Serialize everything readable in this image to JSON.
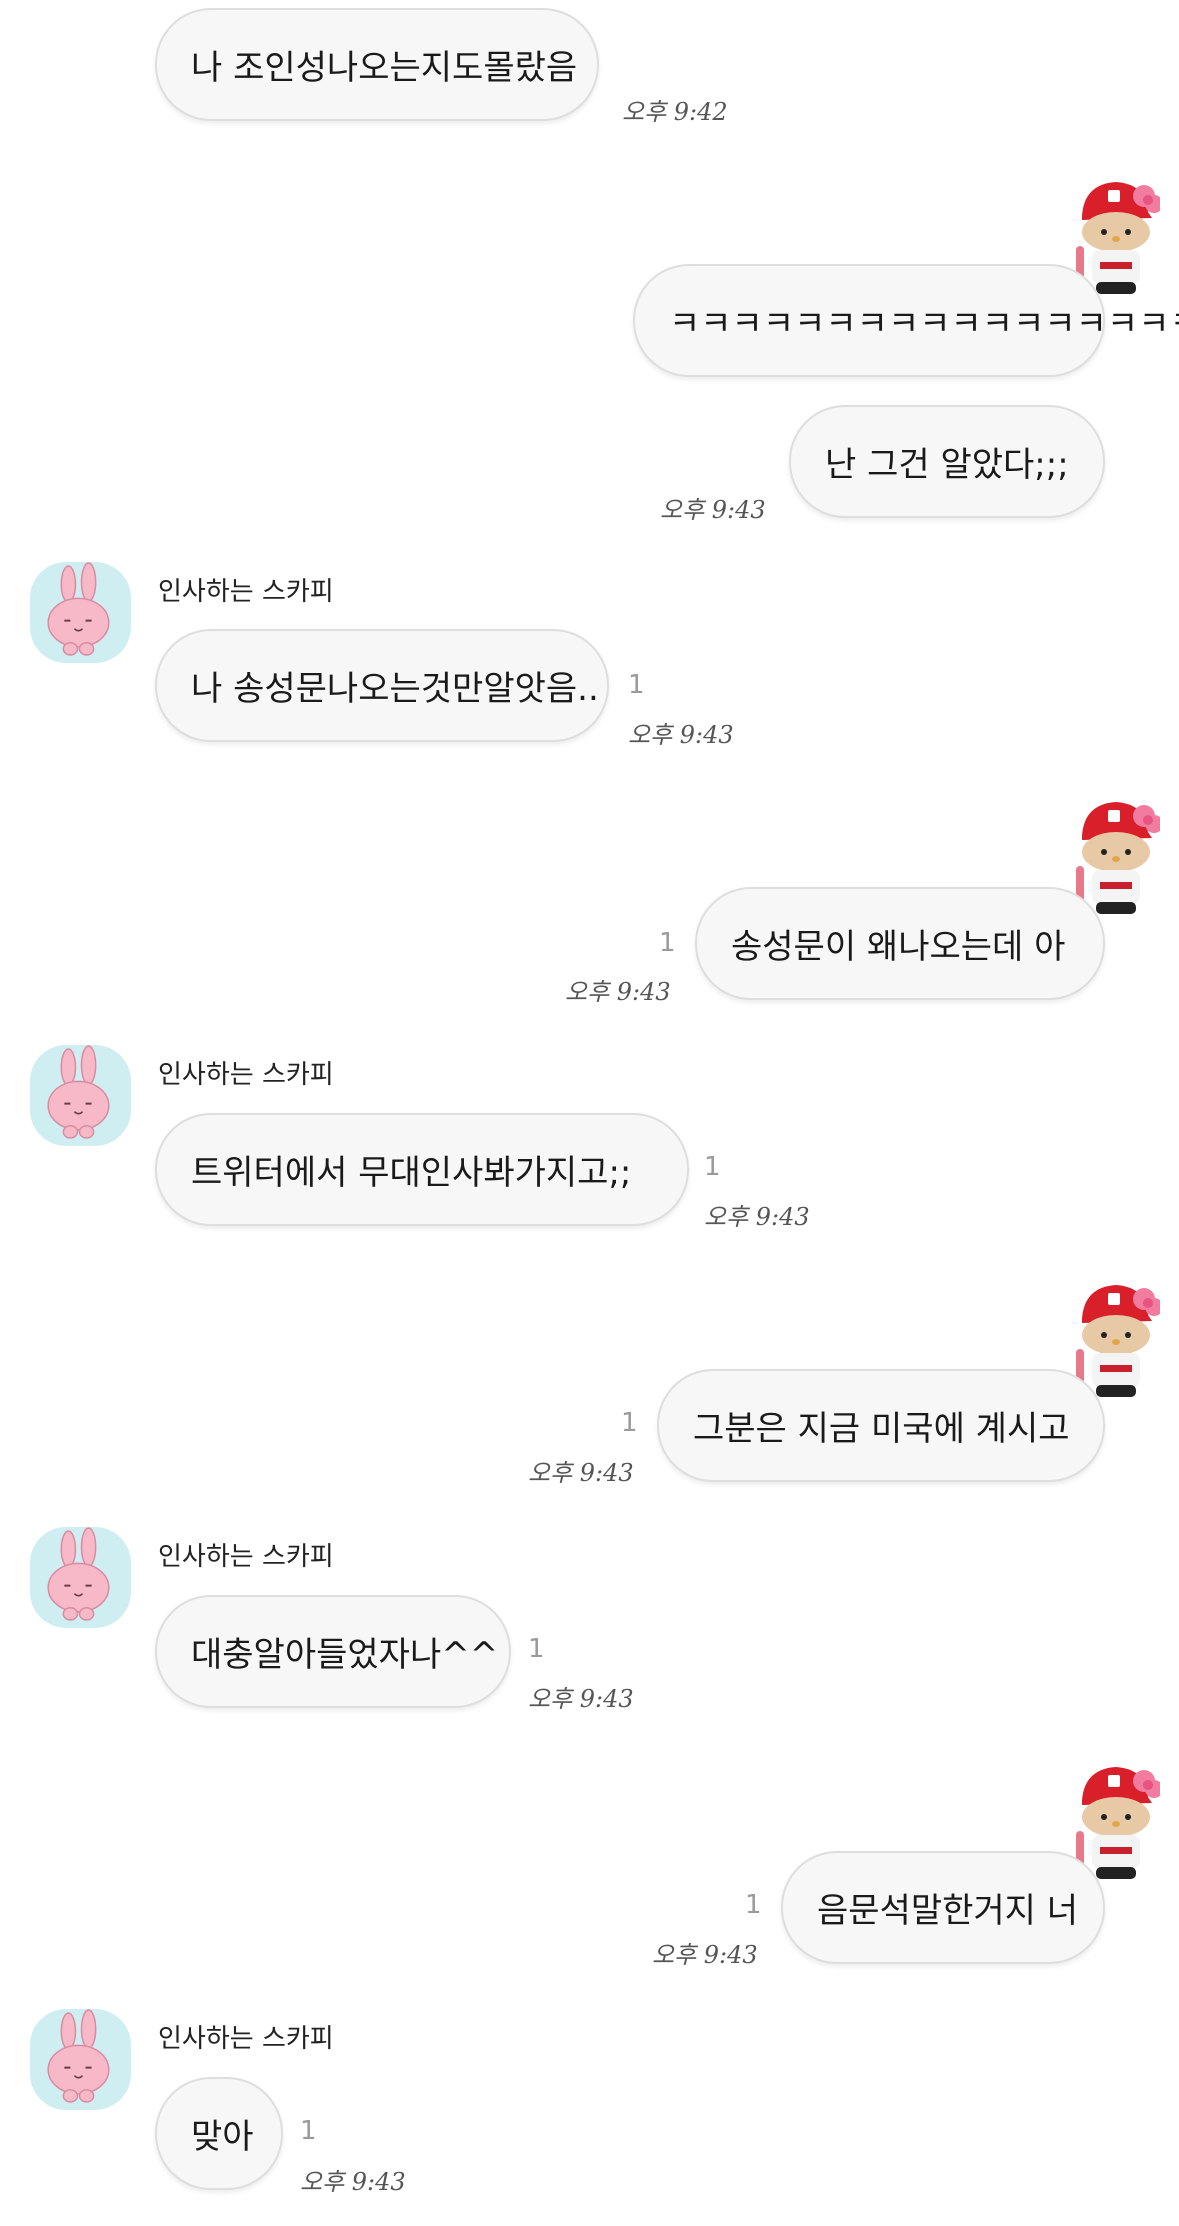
{
  "sender_name": "인사하는 스카피",
  "messages": [
    {
      "text": "나 조인성나오는지도몰랐음",
      "time": "오후 9:42"
    },
    {
      "text": "ㅋㅋㅋㅋㅋㅋㅋㅋㅋㅋㅋㅋㅋㅋㅋㅋㅋ"
    },
    {
      "text": "난 그건 알았다;;;",
      "time": "오후 9:43"
    },
    {
      "text": "나 송성문나오는것만알앗음..",
      "read": "1",
      "time": "오후 9:43"
    },
    {
      "text": "송성문이 왜나오는데 아",
      "read": "1",
      "time": "오후 9:43"
    },
    {
      "text": "트위터에서 무대인사봐가지고;;",
      "read": "1",
      "time": "오후 9:43"
    },
    {
      "text": "그분은 지금 미국에 계시고",
      "read": "1",
      "time": "오후 9:43"
    },
    {
      "text": "대충알아들었자나^^",
      "read": "1",
      "time": "오후 9:43"
    },
    {
      "text": "음문석말한거지 너",
      "read": "1",
      "time": "오후 9:43"
    },
    {
      "text": "맞아",
      "read": "1",
      "time": "오후 9:43"
    }
  ]
}
